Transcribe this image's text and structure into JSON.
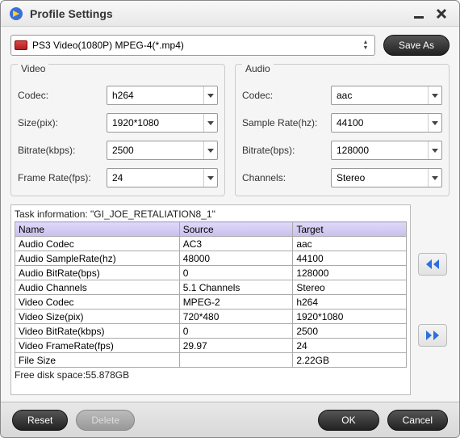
{
  "window": {
    "title": "Profile Settings"
  },
  "profile": {
    "selected": "PS3 Video(1080P) MPEG-4(*.mp4)"
  },
  "buttons": {
    "save_as": "Save As",
    "reset": "Reset",
    "delete": "Delete",
    "ok": "OK",
    "cancel": "Cancel"
  },
  "video": {
    "heading": "Video",
    "codec_label": "Codec:",
    "codec": "h264",
    "size_label": "Size(pix):",
    "size": "1920*1080",
    "bitrate_label": "Bitrate(kbps):",
    "bitrate": "2500",
    "framerate_label": "Frame Rate(fps):",
    "framerate": "24"
  },
  "audio": {
    "heading": "Audio",
    "codec_label": "Codec:",
    "codec": "aac",
    "samplerate_label": "Sample Rate(hz):",
    "samplerate": "44100",
    "bitrate_label": "Bitrate(bps):",
    "bitrate": "128000",
    "channels_label": "Channels:",
    "channels": "Stereo"
  },
  "task": {
    "caption_prefix": "Task information: ",
    "filename": "\"GI_JOE_RETALIATION8_1\"",
    "headers": {
      "name": "Name",
      "source": "Source",
      "target": "Target"
    },
    "rows": [
      {
        "name": "Audio Codec",
        "source": "AC3",
        "target": "aac"
      },
      {
        "name": "Audio SampleRate(hz)",
        "source": "48000",
        "target": "44100"
      },
      {
        "name": "Audio BitRate(bps)",
        "source": "0",
        "target": "128000"
      },
      {
        "name": "Audio Channels",
        "source": "5.1 Channels",
        "target": "Stereo"
      },
      {
        "name": "Video Codec",
        "source": "MPEG-2",
        "target": "h264"
      },
      {
        "name": "Video Size(pix)",
        "source": "720*480",
        "target": "1920*1080"
      },
      {
        "name": "Video BitRate(kbps)",
        "source": "0",
        "target": "2500"
      },
      {
        "name": "Video FrameRate(fps)",
        "source": "29.97",
        "target": "24"
      },
      {
        "name": "File Size",
        "source": "",
        "target": "2.22GB"
      }
    ],
    "free_space": "Free disk space:55.878GB"
  }
}
